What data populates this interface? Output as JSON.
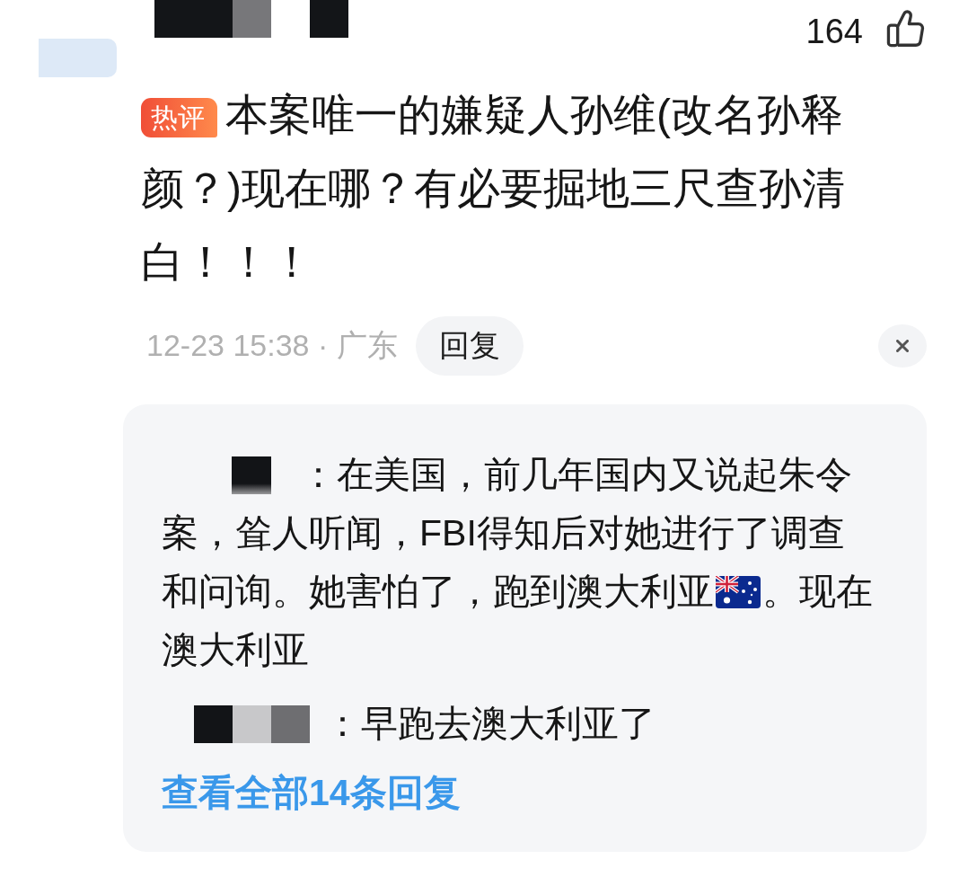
{
  "comment": {
    "likes": "164",
    "badge": "热评",
    "text": "本案唯一的嫌疑人孙维(改名孙释颜？)现在哪？有必要掘地三尺查孙清白！！！",
    "meta": "12-23 15:38 · 广东",
    "reply_button": "回复"
  },
  "replies": {
    "items": [
      {
        "segments": [
          {
            "kind": "text",
            "text": "：在美国，前几年国内又说起朱令案，耸人听闻，FBI得知后对她进行了调查和问询。她害怕了，跑到澳大利亚"
          },
          {
            "kind": "flag"
          },
          {
            "kind": "text",
            "text": "。现在澳大利亚"
          }
        ]
      },
      {
        "segments": [
          {
            "kind": "text",
            "text": "：早跑去澳大利亚了"
          }
        ]
      }
    ],
    "view_all": "查看全部14条回复"
  }
}
